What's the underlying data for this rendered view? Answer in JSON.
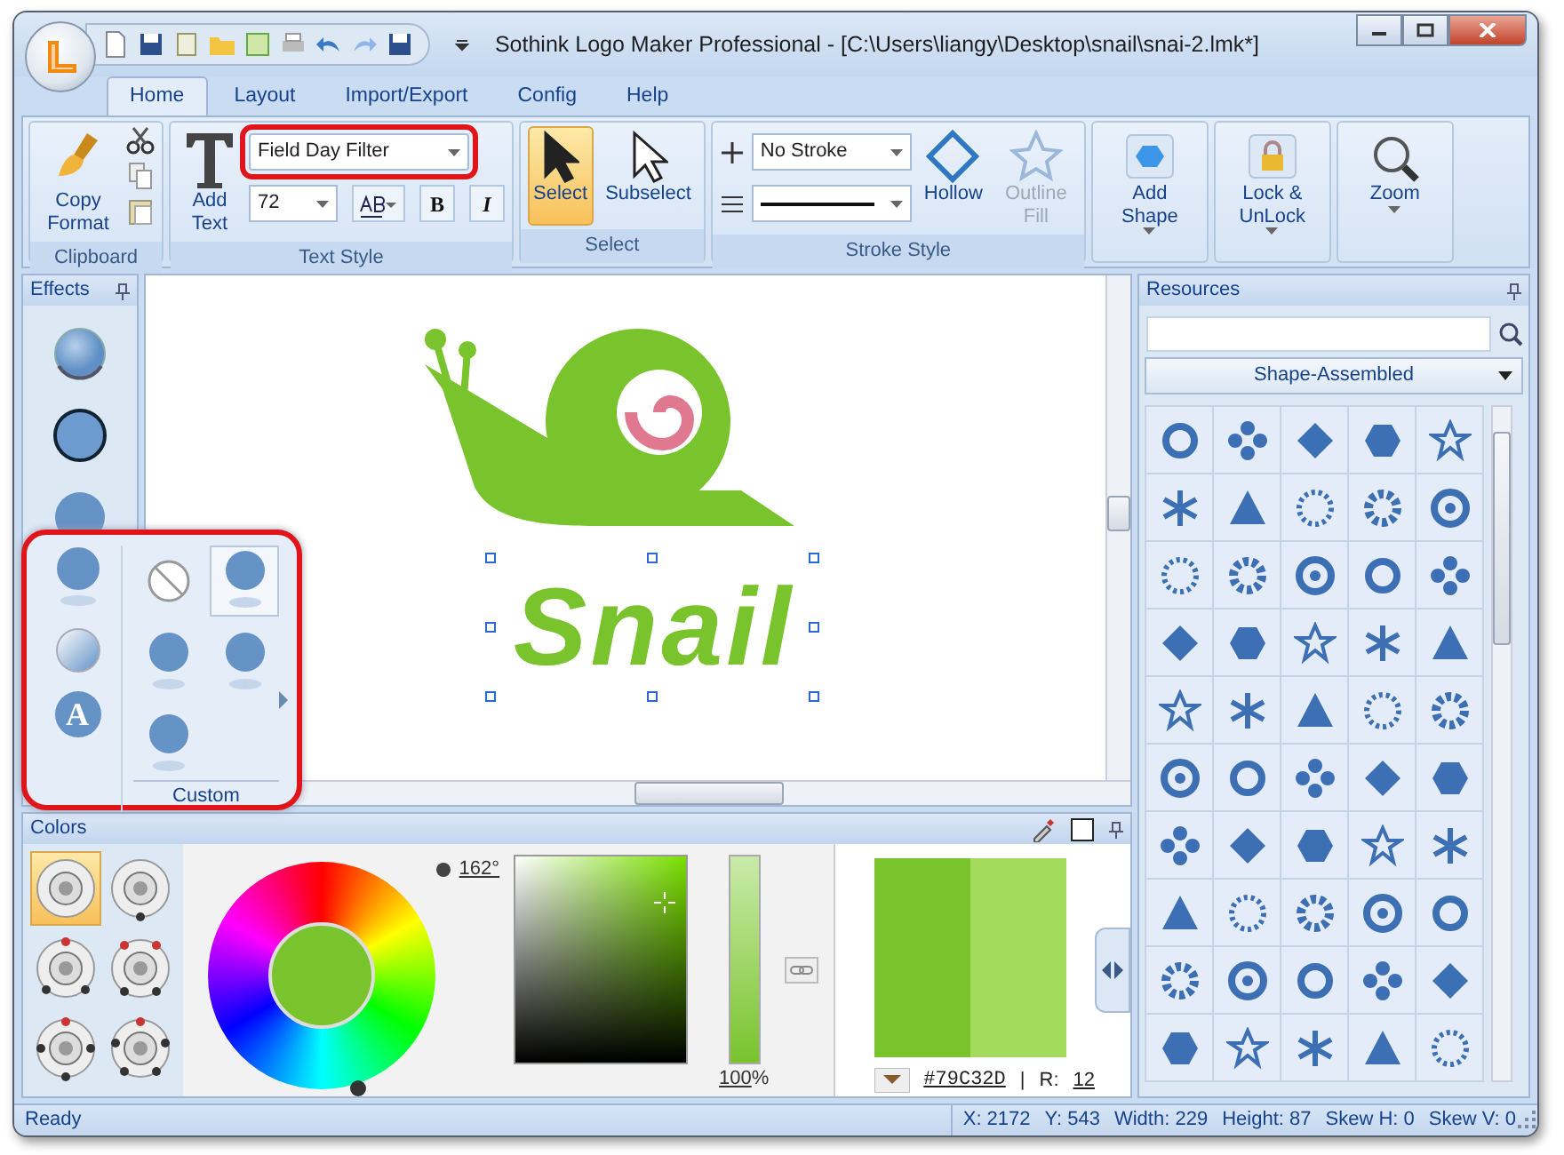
{
  "window": {
    "title": "Sothink Logo Maker Professional - [C:\\Users\\liangy\\Desktop\\snail\\snai-2.lmk*]"
  },
  "tabs": [
    {
      "label": "Home",
      "selected": true
    },
    {
      "label": "Layout",
      "selected": false
    },
    {
      "label": "Import/Export",
      "selected": false
    },
    {
      "label": "Config",
      "selected": false
    },
    {
      "label": "Help",
      "selected": false
    }
  ],
  "clipboard": {
    "label": "Clipboard",
    "copy_format": "Copy Format"
  },
  "text_style": {
    "label": "Text Style",
    "add_text": "Add Text",
    "font": "Field Day Filter",
    "font_highlighted": true,
    "size": "72",
    "bold": "B",
    "italic": "I"
  },
  "select": {
    "label": "Select",
    "tools": [
      {
        "label": "Select",
        "selected": true
      },
      {
        "label": "Subselect",
        "selected": false
      }
    ]
  },
  "stroke_style": {
    "label": "Stroke Style",
    "stroke": "No Stroke",
    "hollow": "Hollow",
    "outline_fill": {
      "label": "Outline Fill",
      "disabled": true
    }
  },
  "add_shape": "Add Shape",
  "lock": "Lock & UnLock",
  "zoom": "Zoom",
  "effects": {
    "title": "Effects"
  },
  "flyout": {
    "highlighted": true,
    "label": "Custom",
    "glyph": "A",
    "items": [
      {
        "selected": false
      },
      {
        "selected": true
      },
      {
        "selected": false
      },
      {
        "selected": false
      },
      {
        "selected": false
      }
    ]
  },
  "canvas": {
    "logo_text": "Snail"
  },
  "colors": {
    "title": "Colors",
    "hue": "162°",
    "opacity": "100",
    "percent": "%",
    "alpha": {
      "level": 1
    },
    "hex": "#79C32D",
    "separator": "|",
    "r_label": "R:",
    "r_value": "12",
    "presets": [
      {
        "selected": true
      },
      {
        "selected": false
      },
      {
        "selected": false
      },
      {
        "selected": false
      },
      {
        "selected": false
      },
      {
        "selected": false
      }
    ],
    "swatches": [
      {
        "color": "#79c32d"
      },
      {
        "color": "#a3dc5c"
      }
    ]
  },
  "resources": {
    "title": "Resources",
    "category": "Shape-Assembled"
  },
  "status_bar": {
    "status": "Ready",
    "fields": [
      "X: 2172",
      "Y: 543",
      "Width: 229",
      "Height: 87",
      "Skew H: 0",
      "Skew V: 0"
    ]
  }
}
